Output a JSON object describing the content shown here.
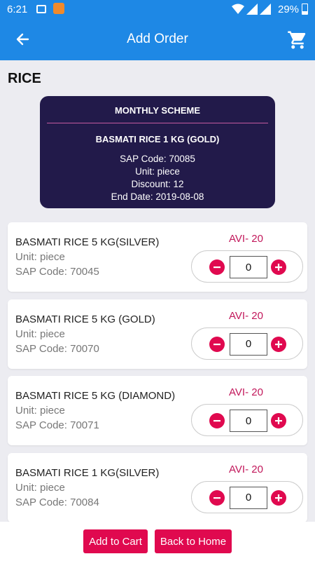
{
  "status_bar": {
    "time": "6:21",
    "battery": "29%"
  },
  "app_bar": {
    "title": "Add Order"
  },
  "category": "RICE",
  "scheme": {
    "title": "MONTHLY SCHEME",
    "product": "BASMATI RICE 1 KG (GOLD)",
    "sap_code": "SAP Code: 70085",
    "unit": "Unit: piece",
    "discount": "Discount: 12",
    "end_date": "End Date: 2019-08-08"
  },
  "products": [
    {
      "name": "BASMATI RICE 5 KG(SILVER)",
      "unit": "Unit: piece",
      "sap": "SAP Code: 70045",
      "avi": "AVI- 20",
      "qty": "0"
    },
    {
      "name": "BASMATI RICE 5 KG (GOLD)",
      "unit": "Unit: piece",
      "sap": "SAP Code: 70070",
      "avi": "AVI- 20",
      "qty": "0"
    },
    {
      "name": "BASMATI RICE 5 KG (DIAMOND)",
      "unit": "Unit: piece",
      "sap": "SAP Code: 70071",
      "avi": "AVI- 20",
      "qty": "0"
    },
    {
      "name": "BASMATI RICE 1 KG(SILVER)",
      "unit": "Unit: piece",
      "sap": "SAP Code: 70084",
      "avi": "AVI- 20",
      "qty": "0"
    }
  ],
  "footer": {
    "add_to_cart": "Add to Cart",
    "back_to_home": "Back to Home"
  },
  "icons": {
    "back": "arrow-back-icon",
    "cart": "shopping-cart-icon",
    "minus": "minus-circle-icon",
    "plus": "plus-circle-icon"
  },
  "colors": {
    "primary": "#1e88e5",
    "accent": "#e0094f",
    "scheme_bg": "#221a4a",
    "avi": "#c2185b"
  }
}
